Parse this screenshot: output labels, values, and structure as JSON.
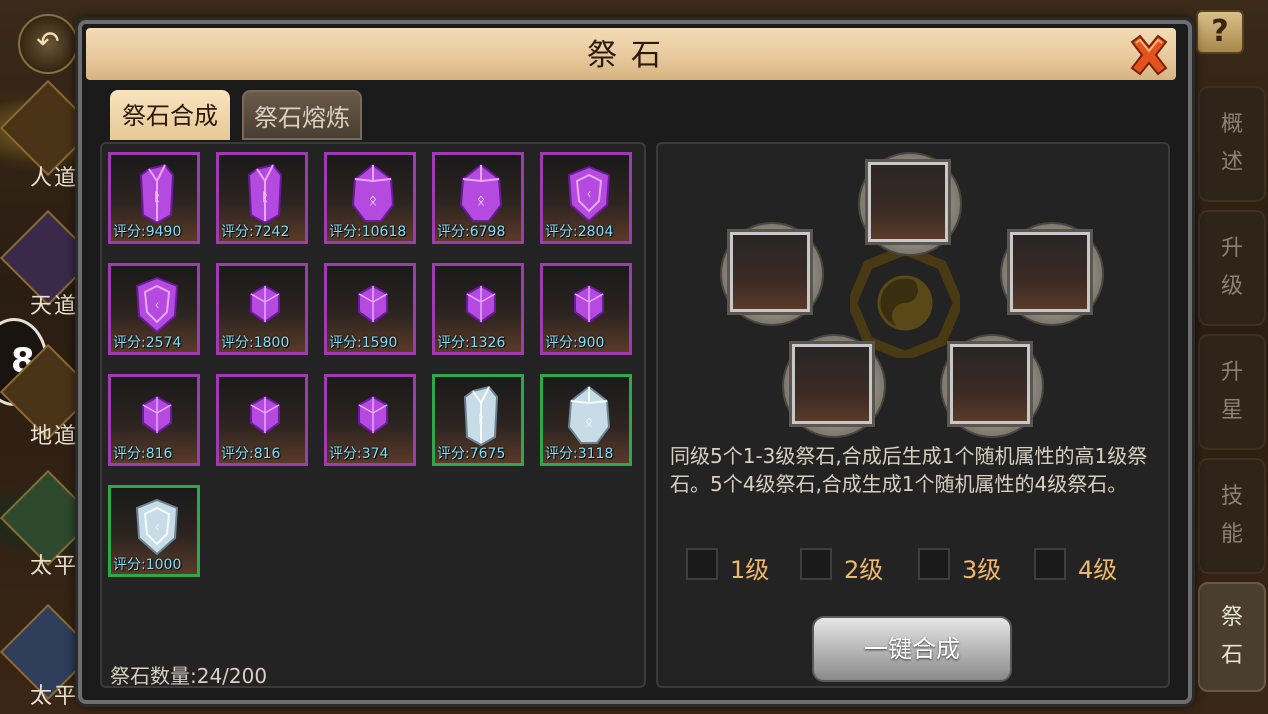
{
  "background": {
    "back_icon": "back-arrow-icon",
    "help_label": "?",
    "left_labels": [
      "人道",
      "天道",
      "地道",
      "太平",
      "太平何谈"
    ],
    "left_button_label": "8"
  },
  "side_tabs": [
    {
      "label": "概\n述",
      "active": false
    },
    {
      "label": "升\n级",
      "active": false
    },
    {
      "label": "升\n星",
      "active": false
    },
    {
      "label": "技\n能",
      "active": false
    },
    {
      "label": "祭\n石",
      "active": true
    }
  ],
  "dialog": {
    "title": "祭石",
    "close_icon": "close-x-icon",
    "tabs": [
      {
        "label": "祭石合成",
        "active": true
      },
      {
        "label": "祭石熔炼",
        "active": false
      }
    ],
    "stones": [
      {
        "shape": "crystal",
        "quality": "purple",
        "score": "评分:9490"
      },
      {
        "shape": "crystal",
        "quality": "purple",
        "score": "评分:7242"
      },
      {
        "shape": "oval",
        "quality": "purple",
        "score": "评分:10618"
      },
      {
        "shape": "oval",
        "quality": "purple",
        "score": "评分:6798"
      },
      {
        "shape": "shield",
        "quality": "purple",
        "score": "评分:2804"
      },
      {
        "shape": "shield",
        "quality": "purple",
        "score": "评分:2574"
      },
      {
        "shape": "small",
        "quality": "purple",
        "score": "评分:1800"
      },
      {
        "shape": "small",
        "quality": "purple",
        "score": "评分:1590"
      },
      {
        "shape": "small",
        "quality": "purple",
        "score": "评分:1326"
      },
      {
        "shape": "small",
        "quality": "purple",
        "score": "评分:900"
      },
      {
        "shape": "small",
        "quality": "purple",
        "score": "评分:816"
      },
      {
        "shape": "small",
        "quality": "purple",
        "score": "评分:816"
      },
      {
        "shape": "small",
        "quality": "purple",
        "score": "评分:374"
      },
      {
        "shape": "crystal",
        "quality": "green",
        "score": "评分:7675"
      },
      {
        "shape": "oval",
        "quality": "green",
        "score": "评分:3118"
      },
      {
        "shape": "shield",
        "quality": "green",
        "score": "评分:1000"
      }
    ],
    "stone_count": "祭石数量:24/200",
    "description": "同级5个1-3级祭石,合成后生成1个随机属性的高1级祭石。5个4级祭石,合成生成1个随机属性的4级祭石。",
    "levels": [
      {
        "label": "1级",
        "checked": false
      },
      {
        "label": "2级",
        "checked": false
      },
      {
        "label": "3级",
        "checked": false
      },
      {
        "label": "4级",
        "checked": false
      }
    ],
    "one_key_button": "一键合成"
  },
  "colors": {
    "purple_border": "#a03ab0",
    "green_border": "#2ea84a",
    "score_text": "#7be3ff",
    "level_text": "#f0b868",
    "header_bg": "#e7c79a"
  }
}
